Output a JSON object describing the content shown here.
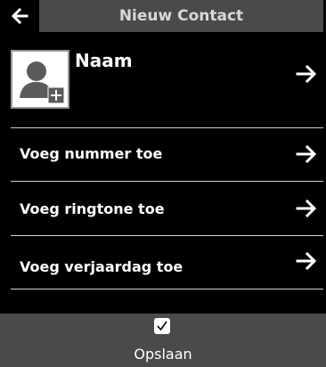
{
  "header": {
    "title": "Nieuw Contact",
    "back_icon": "arrow-left-icon"
  },
  "contact": {
    "name_label": "Naam",
    "avatar_icon": "person-add-icon"
  },
  "menu": [
    {
      "label": "Voeg nummer toe",
      "icon": "arrow-right-icon"
    },
    {
      "label": "Voeg ringtone toe",
      "icon": "arrow-right-icon"
    },
    {
      "label": "Voeg verjaardag toe",
      "icon": "arrow-right-icon"
    }
  ],
  "footer": {
    "save_label": "Opslaan",
    "check_icon": "checkmark-icon"
  },
  "colors": {
    "background": "#000000",
    "bar": "#4a4a4a",
    "divider": "#d0d0d0",
    "text": "#ffffff"
  }
}
